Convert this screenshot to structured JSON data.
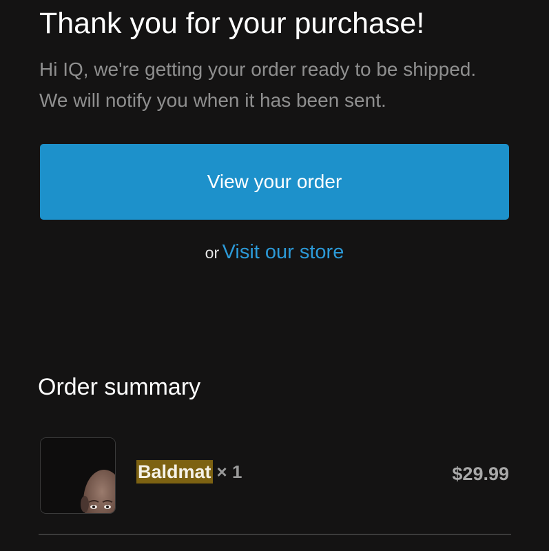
{
  "header": {
    "title": "Thank you for your purchase!",
    "message_line1": "Hi IQ, we're getting your order ready to be shipped.",
    "message_line2": "We will notify you when it has been sent."
  },
  "actions": {
    "view_order_label": "View your order",
    "or_text": "or",
    "visit_store_label": "Visit our store"
  },
  "order_summary": {
    "heading": "Order summary",
    "items": [
      {
        "name": "Baldmat",
        "quantity": "× 1",
        "price": "$29.99"
      }
    ]
  },
  "colors": {
    "background": "#141313",
    "accent": "#1d91cb",
    "link": "#2c9ad8",
    "highlight": "#7d6212"
  }
}
